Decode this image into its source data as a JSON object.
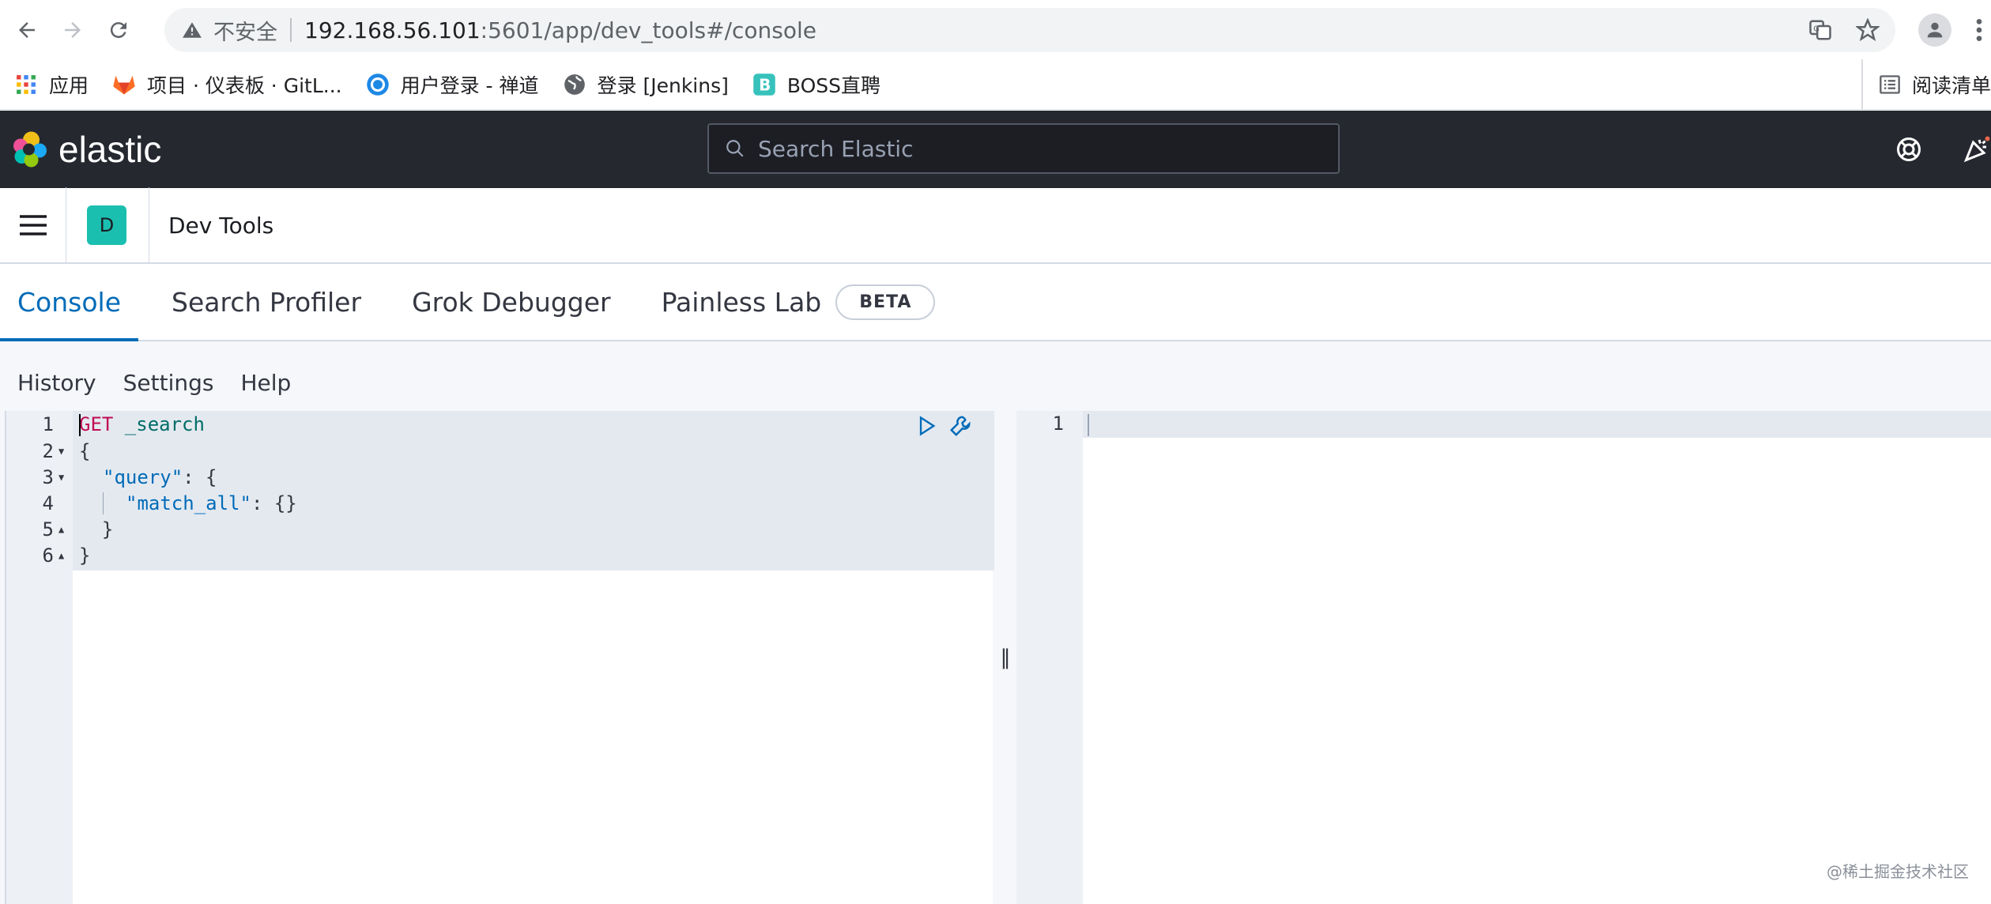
{
  "browser": {
    "insecure_label": "不安全",
    "url_host": "192.168.56.101",
    "url_path": ":5601/app/dev_tools#/console"
  },
  "bookmarks": [
    {
      "label": "应用",
      "icon": "apps-grid-icon"
    },
    {
      "label": "项目 · 仪表板 · GitL...",
      "icon": "gitlab-icon"
    },
    {
      "label": "用户登录 - 禅道",
      "icon": "zentao-icon"
    },
    {
      "label": "登录 [Jenkins]",
      "icon": "globe-icon"
    },
    {
      "label": "BOSS直聘",
      "icon": "boss-icon"
    }
  ],
  "reading_list": "阅读清单",
  "header": {
    "brand": "elastic",
    "search_placeholder": "Search Elastic"
  },
  "breadcrumb": {
    "space_initial": "D",
    "title": "Dev Tools"
  },
  "tabs": [
    {
      "label": "Console",
      "active": true
    },
    {
      "label": "Search Profiler",
      "active": false
    },
    {
      "label": "Grok Debugger",
      "active": false
    },
    {
      "label": "Painless Lab",
      "active": false,
      "badge": "BETA"
    }
  ],
  "console_menu": [
    "History",
    "Settings",
    "Help"
  ],
  "editor": {
    "lines": [
      {
        "n": "1",
        "method": "GET",
        "rest": " _search"
      },
      {
        "n": "2",
        "text": "{"
      },
      {
        "n": "3",
        "key": "\"query\"",
        "rest": ": {"
      },
      {
        "n": "4",
        "key": "\"match_all\"",
        "rest": ": {}"
      },
      {
        "n": "5",
        "text": "  }"
      },
      {
        "n": "6",
        "text": "}"
      }
    ]
  },
  "output": {
    "line_number": "1"
  },
  "watermark": "@稀土掘金技术社区",
  "colors": {
    "header_bg": "#25282f",
    "accent": "#006bb8",
    "space_avatar": "#1bbfb0"
  }
}
